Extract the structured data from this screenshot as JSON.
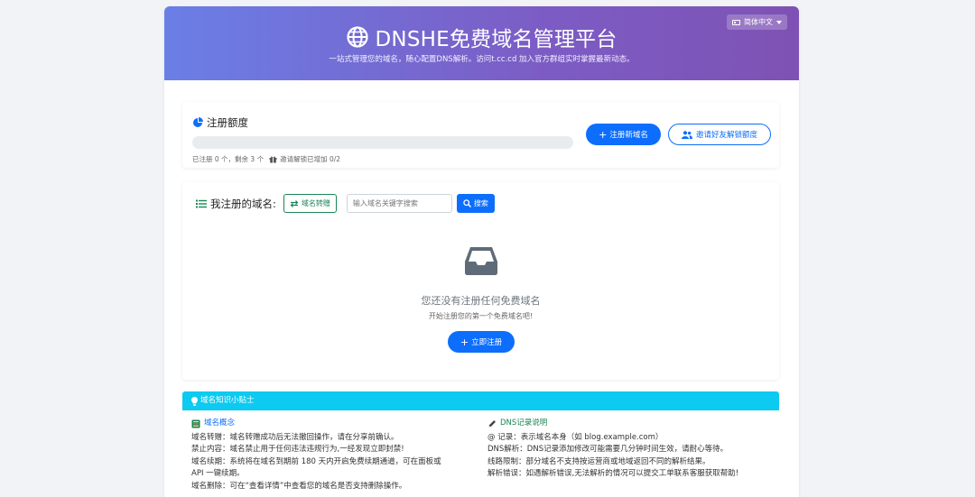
{
  "header": {
    "title": "DNSHE免费域名管理平台",
    "subtitle": "一站式管理您的域名，随心配置DNS解析。访问t.cc.cd 加入官方群组实时掌握最新动态。",
    "language": "简体中文"
  },
  "quota": {
    "title": "注册额度",
    "progress_percent": 0,
    "meta_registered": "已注册 0 个，剩余 3 个",
    "meta_invite": "邀请解锁已增加 0/2",
    "register_button": "注册新域名",
    "invite_button": "邀请好友解锁额度"
  },
  "domains": {
    "title": "我注册的域名:",
    "transfer_button": "域名转赠",
    "search_placeholder": "输入域名关键字搜索",
    "search_button": "搜索",
    "empty_title": "您还没有注册任何免费域名",
    "empty_subtitle": "开始注册您的第一个免费域名吧!",
    "register_now_button": "立即注册"
  },
  "tips": {
    "title": "域名知识小贴士",
    "left": {
      "heading": "域名概念",
      "lines": [
        "域名转赠：域名转赠成功后无法撤回操作，请在分享前确认。",
        "禁止内容：域名禁止用于任何违法违规行为,一经发现立即封禁!",
        "域名续期：系统将在域名到期前 180 天内开启免费续期通道，可在面板或",
        "API 一键续期。",
        "域名删除：可在“查看详情”中查看您的域名是否支持删除操作。"
      ]
    },
    "right": {
      "heading": "DNS记录说明",
      "lines": [
        "@ 记录：表示域名本身（如 blog.example.com）",
        "DNS解析：DNS记录添加修改可能需要几分钟时间生效，请耐心等待。",
        "线路限制：部分域名不支持按运营商或地域返回不同的解析结果。",
        "解析错误：如遇解析错误,无法解析的情况可以提交工单联系客服获取帮助!"
      ]
    }
  },
  "colors": {
    "primary": "#0d6efd",
    "success": "#198754",
    "info": "#0dcaf0",
    "hero_start": "#6a7fe6",
    "hero_end": "#7e52b4"
  }
}
